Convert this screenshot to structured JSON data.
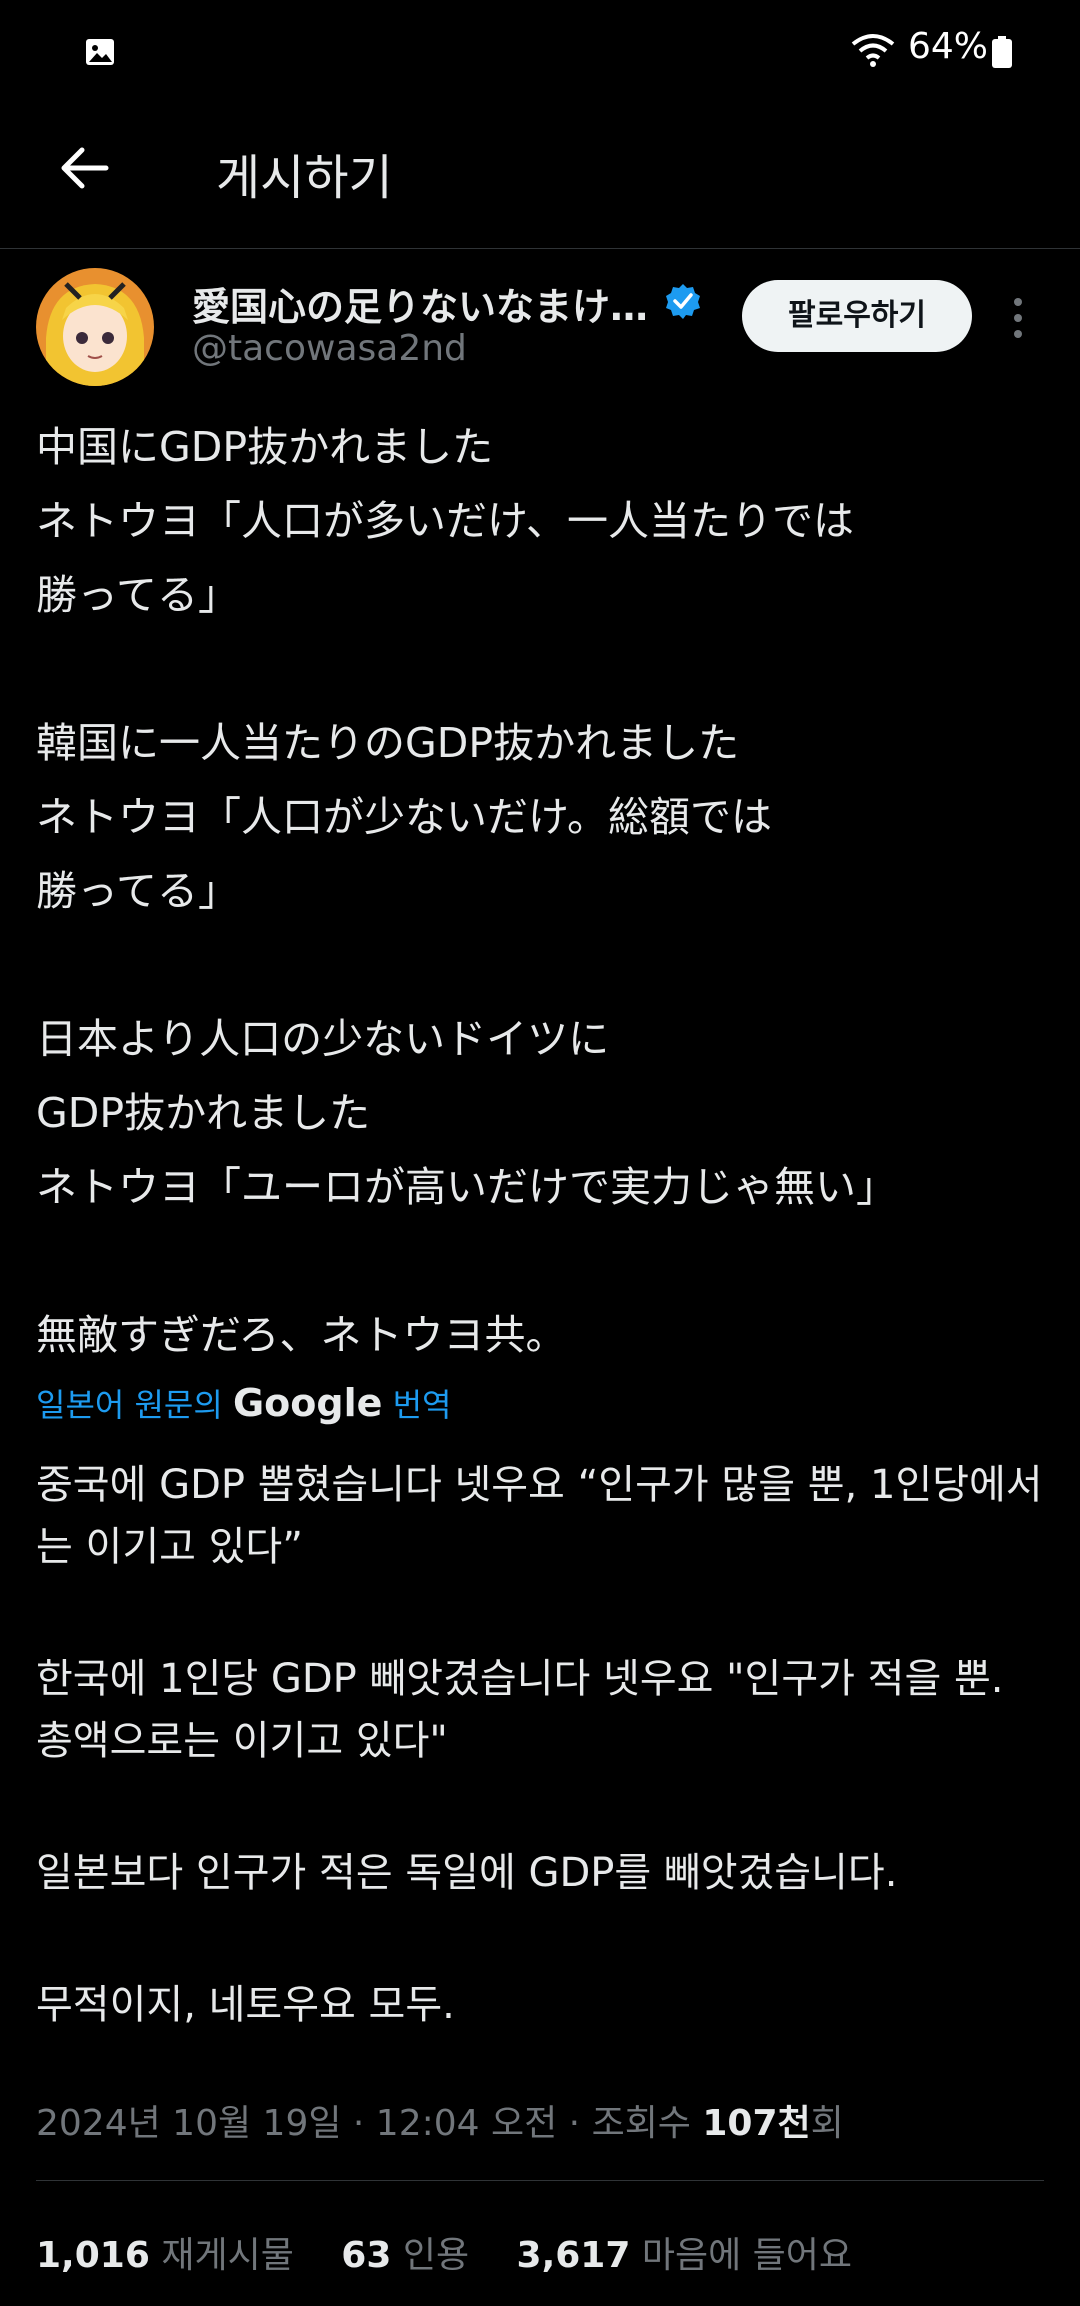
{
  "status_bar": {
    "battery": "64%"
  },
  "appbar": {
    "title": "게시하기"
  },
  "author": {
    "display_name": "愛国心の足りないなまけ…",
    "handle": "@tacowasa2nd",
    "follow_label": "팔로우하기"
  },
  "tweet": {
    "paragraphs": [
      "中国にGDP抜かれました\nネトウヨ「人口が多いだけ、一人当たりでは\n勝ってる」",
      "韓国に一人当たりのGDP抜かれました\nネトウヨ「人口が少ないだけ。総額では\n勝ってる」",
      "日本より人口の少ないドイツに\nGDP抜かれました\nネトウヨ「ユーロが高いだけで実力じゃ無い」",
      "無敵すぎだろ、ネトウヨ共。"
    ]
  },
  "translation": {
    "prefix": "일본어 원문의",
    "brand": "Google",
    "suffix": "번역",
    "paragraphs": [
      "중국에 GDP 뽑혔습니다 넷우요 “인구가 많을 뿐, 1인당에서는 이기고 있다”",
      "한국에 1인당 GDP 빼앗겼습니다 넷우요 \"인구가 적을 뿐. 총액으로는 이기고 있다\"",
      "일본보다 인구가 적은 독일에 GDP를 빼앗겼습니다.",
      "무적이지, 네토우요 모두."
    ]
  },
  "meta": {
    "timestamp": "2024년 10월 19일 · 12:04 오전 · 조회수 ",
    "views": "107천",
    "views_suffix": "회"
  },
  "stats": {
    "reposts_count": "1,016",
    "reposts_label": "재게시물",
    "quotes_count": "63",
    "quotes_label": "인용",
    "likes_count": "3,617",
    "likes_label": "마음에 들어요"
  },
  "colors": {
    "accent": "#1d9bf0",
    "background": "#000000",
    "muted": "#71767b"
  }
}
